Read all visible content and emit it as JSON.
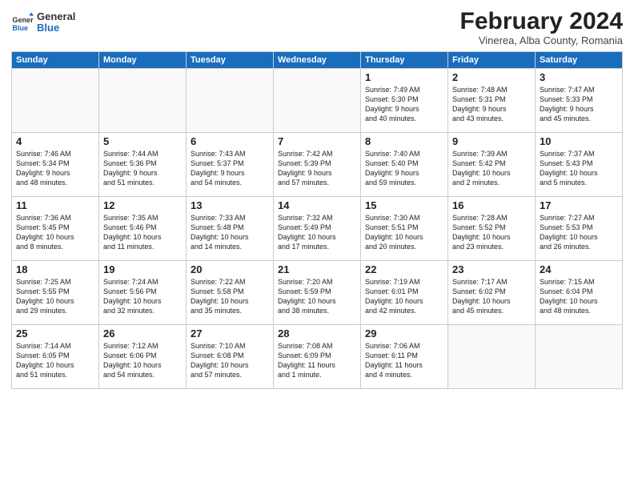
{
  "header": {
    "logo_general": "General",
    "logo_blue": "Blue",
    "month_year": "February 2024",
    "location": "Vinerea, Alba County, Romania"
  },
  "weekdays": [
    "Sunday",
    "Monday",
    "Tuesday",
    "Wednesday",
    "Thursday",
    "Friday",
    "Saturday"
  ],
  "weeks": [
    [
      {
        "day": "",
        "info": ""
      },
      {
        "day": "",
        "info": ""
      },
      {
        "day": "",
        "info": ""
      },
      {
        "day": "",
        "info": ""
      },
      {
        "day": "1",
        "info": "Sunrise: 7:49 AM\nSunset: 5:30 PM\nDaylight: 9 hours\nand 40 minutes."
      },
      {
        "day": "2",
        "info": "Sunrise: 7:48 AM\nSunset: 5:31 PM\nDaylight: 9 hours\nand 43 minutes."
      },
      {
        "day": "3",
        "info": "Sunrise: 7:47 AM\nSunset: 5:33 PM\nDaylight: 9 hours\nand 45 minutes."
      }
    ],
    [
      {
        "day": "4",
        "info": "Sunrise: 7:46 AM\nSunset: 5:34 PM\nDaylight: 9 hours\nand 48 minutes."
      },
      {
        "day": "5",
        "info": "Sunrise: 7:44 AM\nSunset: 5:36 PM\nDaylight: 9 hours\nand 51 minutes."
      },
      {
        "day": "6",
        "info": "Sunrise: 7:43 AM\nSunset: 5:37 PM\nDaylight: 9 hours\nand 54 minutes."
      },
      {
        "day": "7",
        "info": "Sunrise: 7:42 AM\nSunset: 5:39 PM\nDaylight: 9 hours\nand 57 minutes."
      },
      {
        "day": "8",
        "info": "Sunrise: 7:40 AM\nSunset: 5:40 PM\nDaylight: 9 hours\nand 59 minutes."
      },
      {
        "day": "9",
        "info": "Sunrise: 7:39 AM\nSunset: 5:42 PM\nDaylight: 10 hours\nand 2 minutes."
      },
      {
        "day": "10",
        "info": "Sunrise: 7:37 AM\nSunset: 5:43 PM\nDaylight: 10 hours\nand 5 minutes."
      }
    ],
    [
      {
        "day": "11",
        "info": "Sunrise: 7:36 AM\nSunset: 5:45 PM\nDaylight: 10 hours\nand 8 minutes."
      },
      {
        "day": "12",
        "info": "Sunrise: 7:35 AM\nSunset: 5:46 PM\nDaylight: 10 hours\nand 11 minutes."
      },
      {
        "day": "13",
        "info": "Sunrise: 7:33 AM\nSunset: 5:48 PM\nDaylight: 10 hours\nand 14 minutes."
      },
      {
        "day": "14",
        "info": "Sunrise: 7:32 AM\nSunset: 5:49 PM\nDaylight: 10 hours\nand 17 minutes."
      },
      {
        "day": "15",
        "info": "Sunrise: 7:30 AM\nSunset: 5:51 PM\nDaylight: 10 hours\nand 20 minutes."
      },
      {
        "day": "16",
        "info": "Sunrise: 7:28 AM\nSunset: 5:52 PM\nDaylight: 10 hours\nand 23 minutes."
      },
      {
        "day": "17",
        "info": "Sunrise: 7:27 AM\nSunset: 5:53 PM\nDaylight: 10 hours\nand 26 minutes."
      }
    ],
    [
      {
        "day": "18",
        "info": "Sunrise: 7:25 AM\nSunset: 5:55 PM\nDaylight: 10 hours\nand 29 minutes."
      },
      {
        "day": "19",
        "info": "Sunrise: 7:24 AM\nSunset: 5:56 PM\nDaylight: 10 hours\nand 32 minutes."
      },
      {
        "day": "20",
        "info": "Sunrise: 7:22 AM\nSunset: 5:58 PM\nDaylight: 10 hours\nand 35 minutes."
      },
      {
        "day": "21",
        "info": "Sunrise: 7:20 AM\nSunset: 5:59 PM\nDaylight: 10 hours\nand 38 minutes."
      },
      {
        "day": "22",
        "info": "Sunrise: 7:19 AM\nSunset: 6:01 PM\nDaylight: 10 hours\nand 42 minutes."
      },
      {
        "day": "23",
        "info": "Sunrise: 7:17 AM\nSunset: 6:02 PM\nDaylight: 10 hours\nand 45 minutes."
      },
      {
        "day": "24",
        "info": "Sunrise: 7:15 AM\nSunset: 6:04 PM\nDaylight: 10 hours\nand 48 minutes."
      }
    ],
    [
      {
        "day": "25",
        "info": "Sunrise: 7:14 AM\nSunset: 6:05 PM\nDaylight: 10 hours\nand 51 minutes."
      },
      {
        "day": "26",
        "info": "Sunrise: 7:12 AM\nSunset: 6:06 PM\nDaylight: 10 hours\nand 54 minutes."
      },
      {
        "day": "27",
        "info": "Sunrise: 7:10 AM\nSunset: 6:08 PM\nDaylight: 10 hours\nand 57 minutes."
      },
      {
        "day": "28",
        "info": "Sunrise: 7:08 AM\nSunset: 6:09 PM\nDaylight: 11 hours\nand 1 minute."
      },
      {
        "day": "29",
        "info": "Sunrise: 7:06 AM\nSunset: 6:11 PM\nDaylight: 11 hours\nand 4 minutes."
      },
      {
        "day": "",
        "info": ""
      },
      {
        "day": "",
        "info": ""
      }
    ]
  ]
}
